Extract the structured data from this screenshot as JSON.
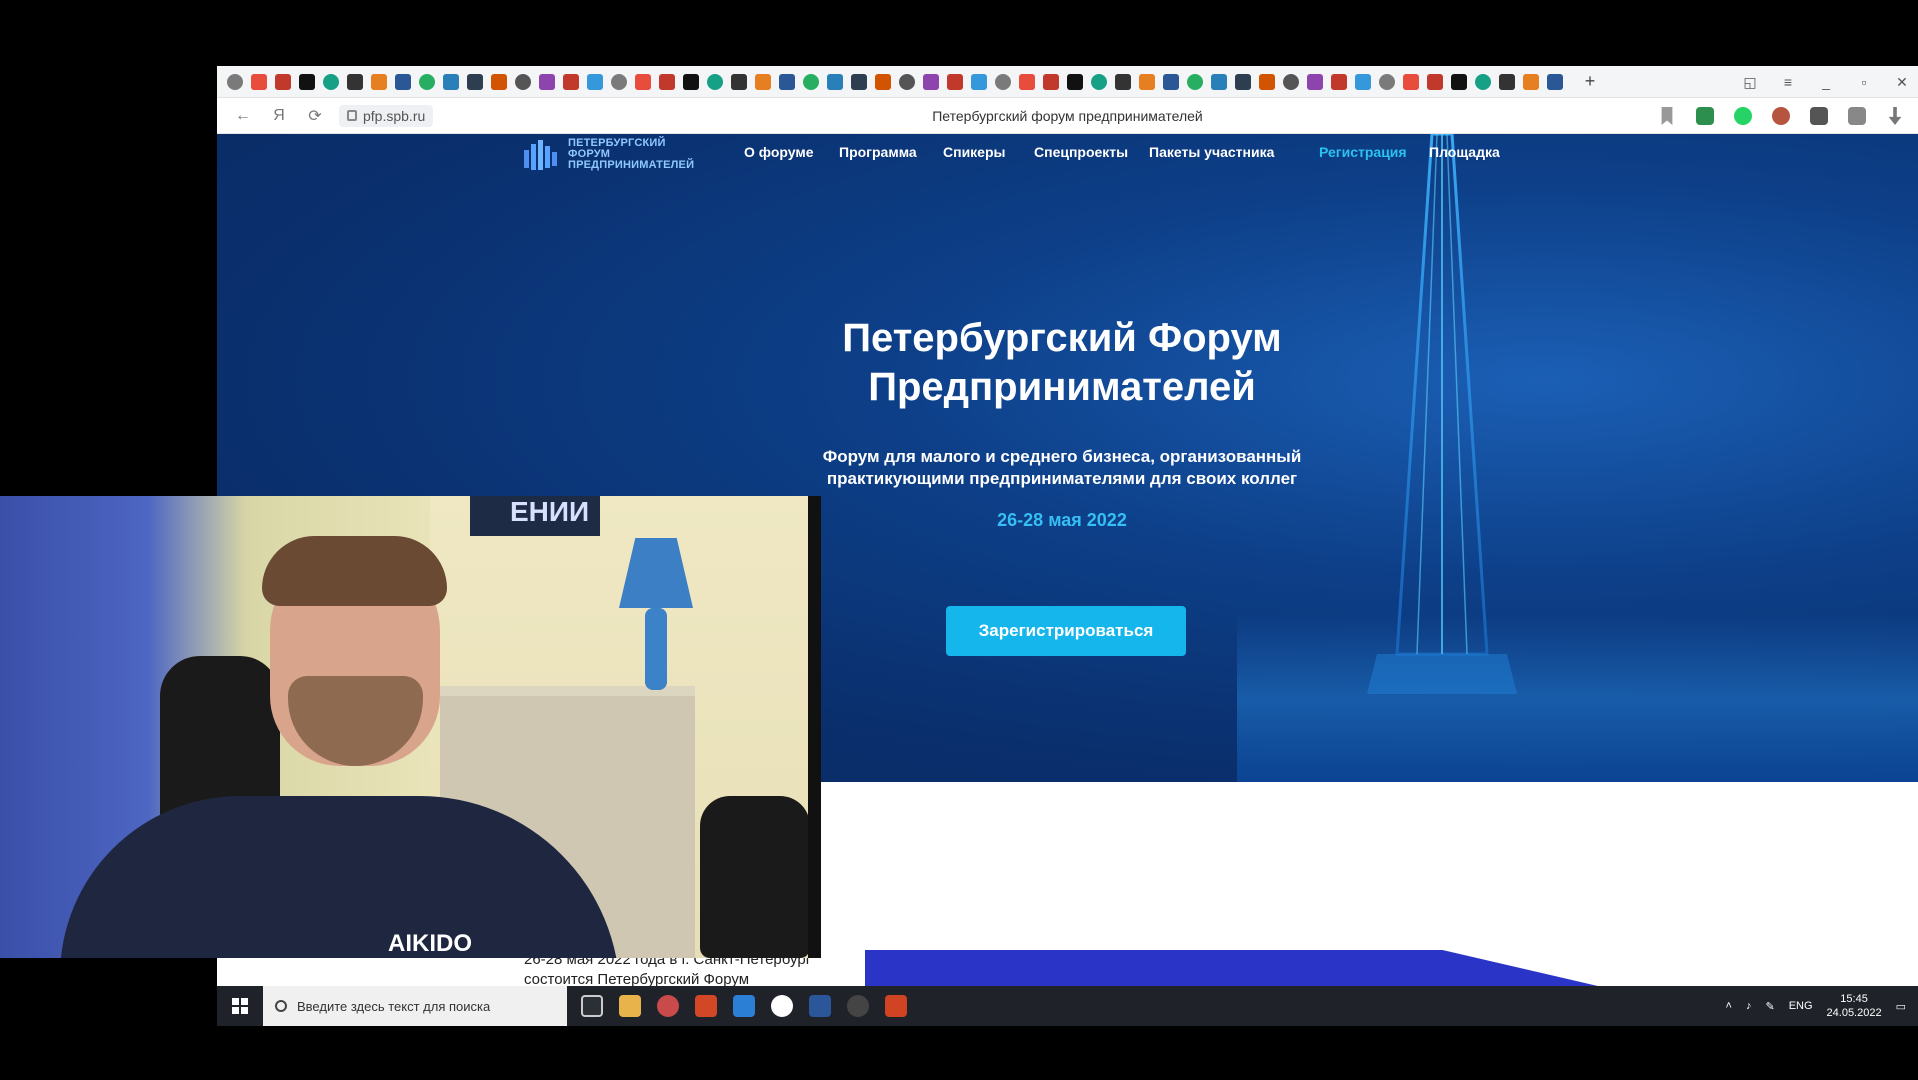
{
  "browser": {
    "url": "pfp.spb.ru",
    "tab_title": "Петербургский форум предпринимателей",
    "new_tab": "+",
    "controls": {
      "minimize": "_",
      "restore": "▫",
      "close": "✕",
      "tab_menu": "≡",
      "bookmark": "◱"
    }
  },
  "site": {
    "logo": {
      "line1": "ПЕТЕРБУРГСКИЙ",
      "line2": "ФОРУМ",
      "line3": "ПРЕДПРИНИМАТЕЛЕЙ"
    },
    "menu": [
      "О форуме",
      "Программа",
      "Спикеры",
      "Спецпроекты",
      "Пакеты участника",
      "Регистрация",
      "Площадка"
    ],
    "hero_title_line1": "Петербургский Форум",
    "hero_title_line2": "Предпринимателей",
    "hero_subtitle_line1": "Форум для малого и среднего бизнеса, организованный",
    "hero_subtitle_line2": "практикующими предпринимателями для своих коллег",
    "hero_date": "26-28 мая 2022",
    "cta_label": "Зарегистрироваться",
    "below_text_line1": "26-28 мая 2022 года в г. Санкт-Петербург",
    "below_text_line2": "состоится Петербургский Форум"
  },
  "taskbar": {
    "search_placeholder": "Введите здесь текст для поиска",
    "lang": "ENG",
    "time": "15:45",
    "date": "24.05.2022"
  },
  "webcam": {
    "poster_text": "ЕНИИ",
    "shirt_text": "AIKIDO"
  },
  "colors": {
    "hero_bg": "#0a2f6d",
    "accent": "#15b6ec",
    "active_menu": "#2bc2f0",
    "banner": "#2a35c8"
  }
}
